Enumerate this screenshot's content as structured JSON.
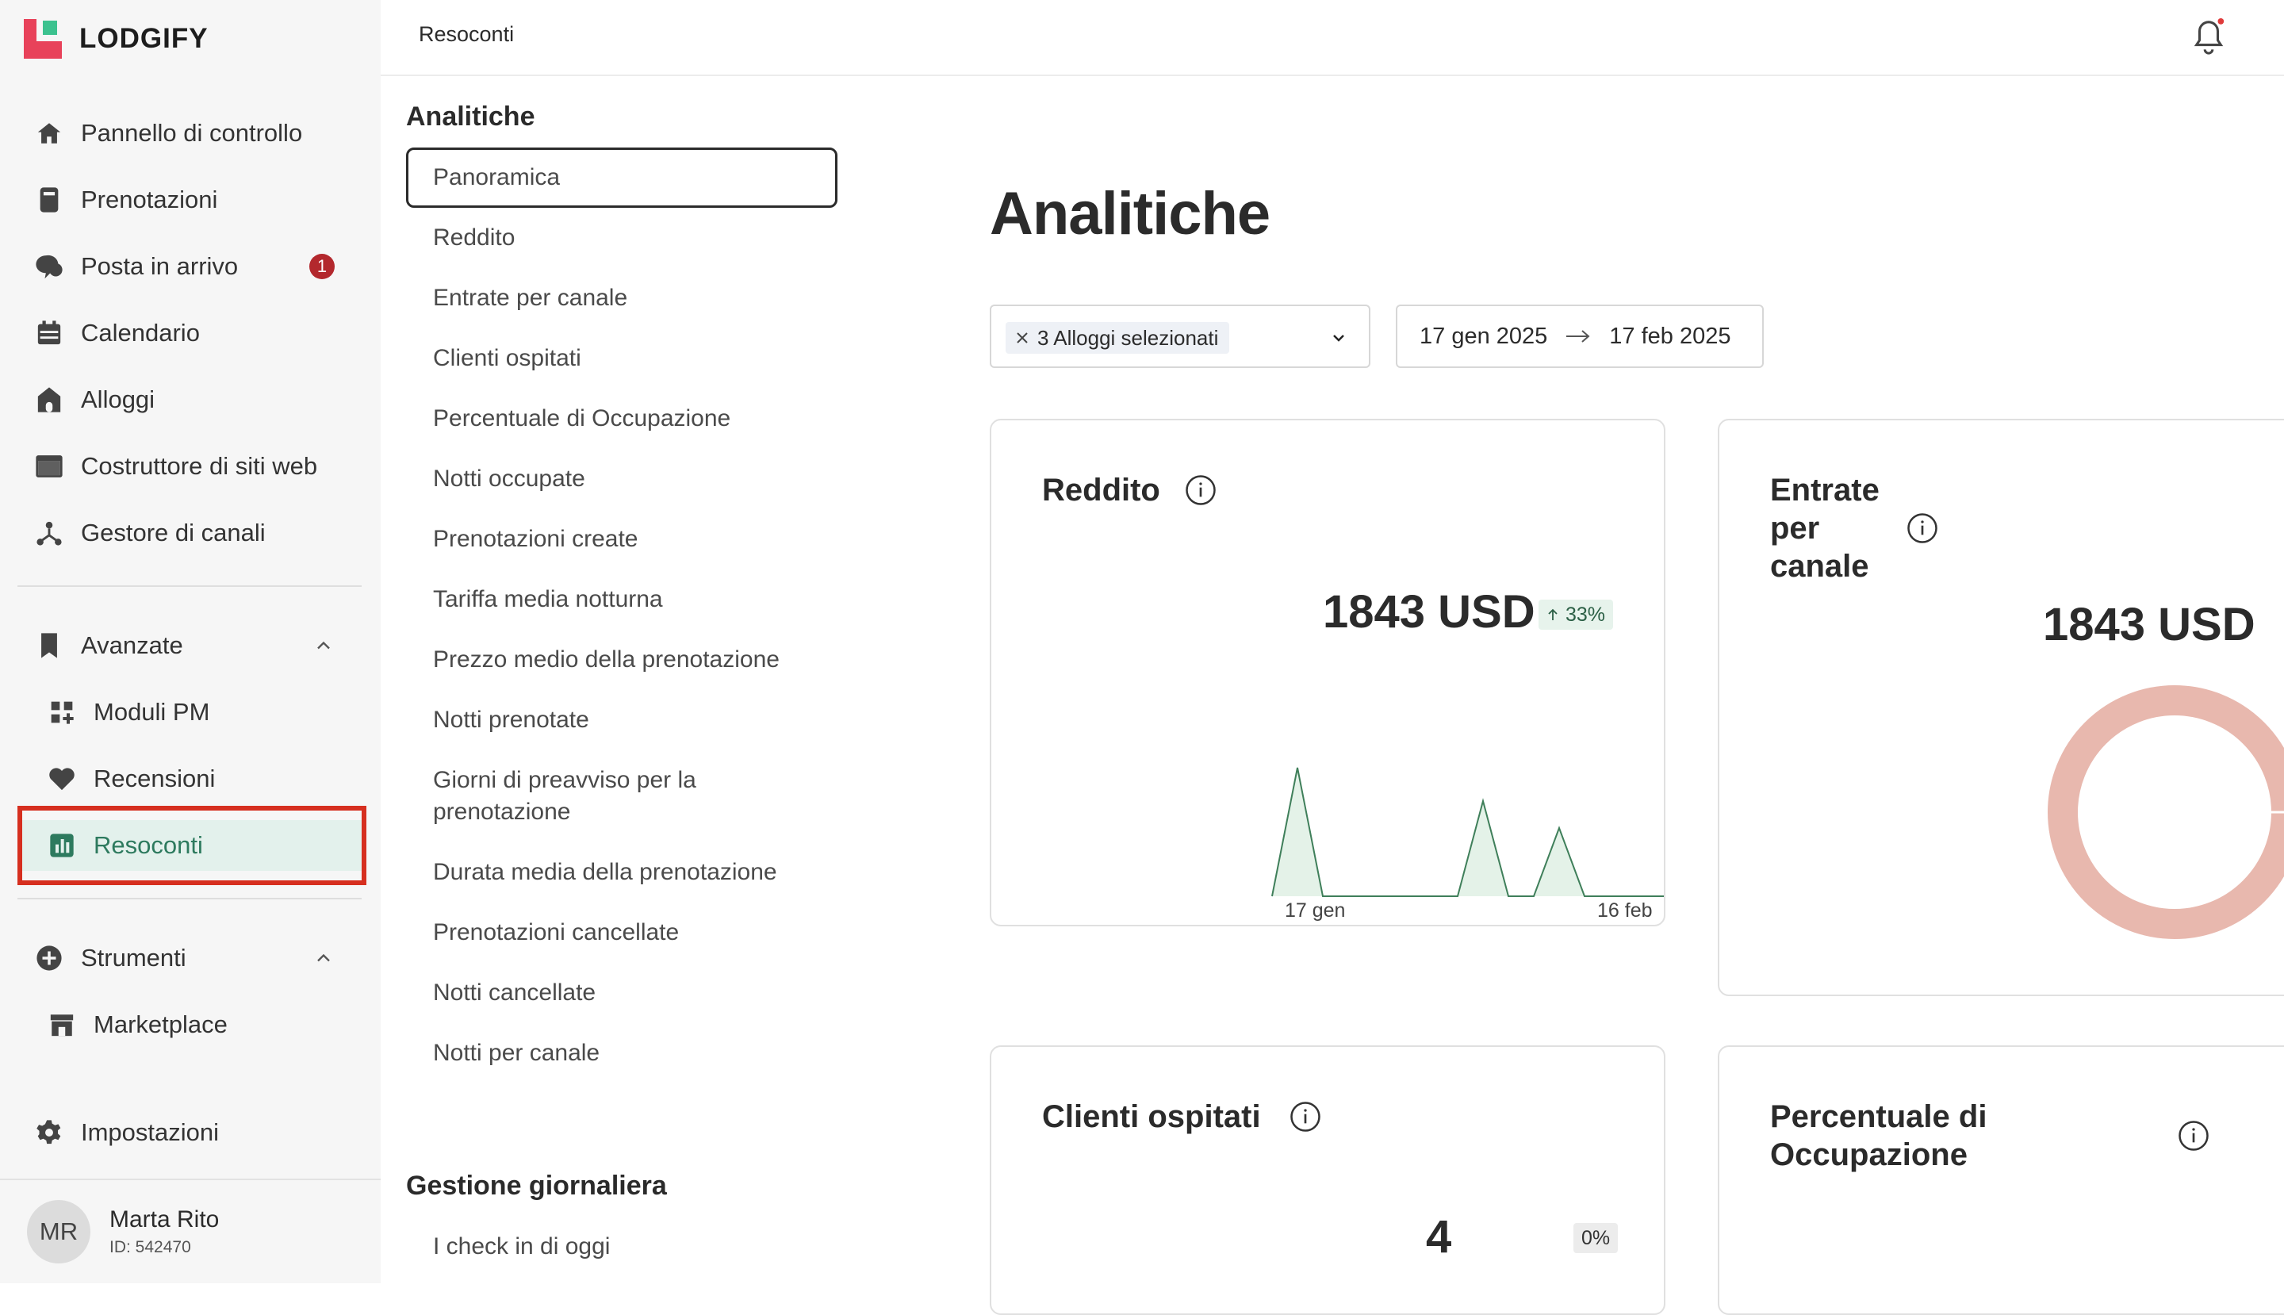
{
  "app": {
    "brand": "LODGIFY"
  },
  "sidebar": {
    "items": [
      {
        "label": "Pannello di controllo",
        "icon": "home-icon"
      },
      {
        "label": "Prenotazioni",
        "icon": "book-icon"
      },
      {
        "label": "Posta in arrivo",
        "icon": "chat-icon",
        "badge": "1"
      },
      {
        "label": "Calendario",
        "icon": "calendar-icon"
      },
      {
        "label": "Alloggi",
        "icon": "house-icon"
      },
      {
        "label": "Costruttore di siti web",
        "icon": "browser-icon"
      },
      {
        "label": "Gestore di canali",
        "icon": "network-icon"
      }
    ],
    "advanced": {
      "label": "Avanzate",
      "items": [
        {
          "label": "Moduli PM",
          "icon": "grid-plus-icon"
        },
        {
          "label": "Recensioni",
          "icon": "heart-icon"
        },
        {
          "label": "Resoconti",
          "icon": "bar-chart-icon",
          "active": true
        }
      ]
    },
    "tools": {
      "label": "Strumenti",
      "items": [
        {
          "label": "Marketplace",
          "icon": "store-icon"
        }
      ]
    },
    "settings": {
      "label": "Impostazioni"
    },
    "user": {
      "initials": "MR",
      "name": "Marta Rito",
      "id": "ID: 542470"
    }
  },
  "topbar": {
    "breadcrumb": "Resoconti"
  },
  "subnav": {
    "analytics_title": "Analitiche",
    "analytics_items": [
      "Panoramica",
      "Reddito",
      "Entrate per canale",
      "Clienti ospitati",
      "Percentuale di Occupazione",
      "Notti occupate",
      "Prenotazioni create",
      "Tariffa media notturna",
      "Prezzo medio della prenotazione",
      "Notti prenotate",
      "Giorni di preavviso per la prenotazione",
      "Durata media della prenotazione",
      "Prenotazioni cancellate",
      "Notti cancellate",
      "Notti per canale"
    ],
    "daily_title": "Gestione giornaliera",
    "daily_items": [
      "I check in di oggi"
    ]
  },
  "main": {
    "title": "Analitiche",
    "filter": {
      "chip": "3 Alloggi selezionati"
    },
    "date_range": {
      "start": "17 gen 2025",
      "end": "17 feb 2025"
    },
    "cards": {
      "revenue": {
        "title": "Reddito",
        "value": "1843 USD",
        "delta": "33%",
        "x_start": "17 gen",
        "x_end": "16 feb"
      },
      "channel": {
        "title": "Entrate per canale",
        "value": "1843 USD"
      },
      "guests": {
        "title": "Clienti ospitati",
        "value": "4",
        "delta": "0%"
      },
      "occupancy": {
        "title": "Percentuale di Occupazione"
      }
    }
  },
  "colors": {
    "accent": "#2d7a5e",
    "highlight": "#d62f1f",
    "badge": "#b3282d",
    "donut": "#e8b8ae",
    "spark_fill": "#e4f2e8",
    "spark_line": "#3f7f5a"
  }
}
